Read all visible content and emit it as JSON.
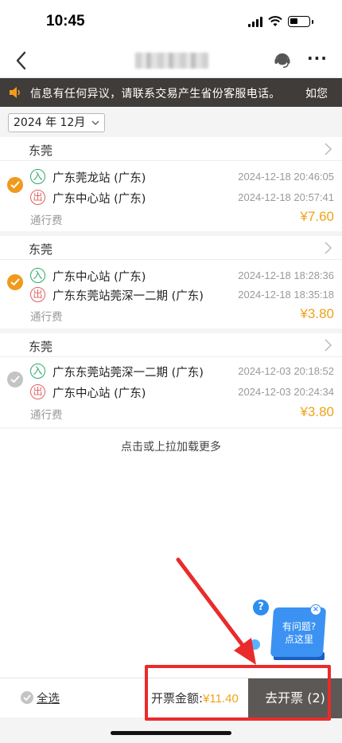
{
  "status_bar": {
    "time": "10:45"
  },
  "notice": {
    "text": "信息有任何异议，请联系交易产生省份客服电话。",
    "text_tail": "如您"
  },
  "filter": {
    "month": "2024 年 12月"
  },
  "trips": [
    {
      "region": "东莞",
      "selected": true,
      "entry": {
        "badge": "入",
        "station": "广东莞龙站 (广东)",
        "time": "2024-12-18 20:46:05"
      },
      "exit": {
        "badge": "出",
        "station": "广东中心站 (广东)",
        "time": "2024-12-18 20:57:41"
      },
      "fee_label": "通行费",
      "fee": "¥7.60"
    },
    {
      "region": "东莞",
      "selected": true,
      "entry": {
        "badge": "入",
        "station": "广东中心站 (广东)",
        "time": "2024-12-18 18:28:36"
      },
      "exit": {
        "badge": "出",
        "station": "广东东莞站莞深一二期 (广东)",
        "time": "2024-12-18 18:35:18"
      },
      "fee_label": "通行费",
      "fee": "¥3.80"
    },
    {
      "region": "东莞",
      "selected": false,
      "entry": {
        "badge": "入",
        "station": "广东东莞站莞深一二期 (广东)",
        "time": "2024-12-03 20:18:52"
      },
      "exit": {
        "badge": "出",
        "station": "广东中心站 (广东)",
        "time": "2024-12-03 20:24:34"
      },
      "fee_label": "通行费",
      "fee": "¥3.80"
    }
  ],
  "load_more": "点击或上拉加载更多",
  "help": {
    "q": "?",
    "line1": "有问题?",
    "line2": "点这里",
    "close": "×"
  },
  "footer": {
    "select_all": "全选",
    "total_label": "开票金额:",
    "total_amount": "¥11.40",
    "invoice_button": "去开票 (2)"
  },
  "colors": {
    "accent": "#f09a1d",
    "annotation": "#ea2b2b",
    "notice_bg": "#3f3c39",
    "button_bg": "#5b5856"
  }
}
